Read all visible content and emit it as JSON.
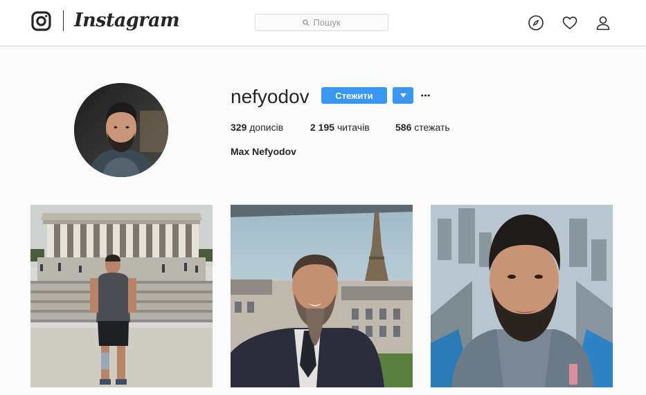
{
  "header": {
    "brand": "Instagram",
    "search_placeholder": "Пошук",
    "icons": [
      "instagram-logo-icon",
      "explore-compass-icon",
      "activity-heart-icon",
      "profile-user-icon"
    ]
  },
  "profile": {
    "username": "nefyodov",
    "follow_label": "Стежити",
    "posts_count": "329",
    "posts_label": "дописів",
    "followers_count": "2 195",
    "followers_label": "читачів",
    "following_count": "586",
    "following_label": "стежать",
    "full_name": "Max Nefyodov"
  },
  "posts": [
    {
      "subject": "Man standing in front of the Lincoln Memorial"
    },
    {
      "subject": "Selfie with the Eiffel Tower in the background"
    },
    {
      "subject": "Close-up selfie above a city skyline"
    }
  ],
  "colors": {
    "accent": "#3897f0",
    "border": "#dbdbdb",
    "background": "#fafafa",
    "text": "#262626"
  }
}
